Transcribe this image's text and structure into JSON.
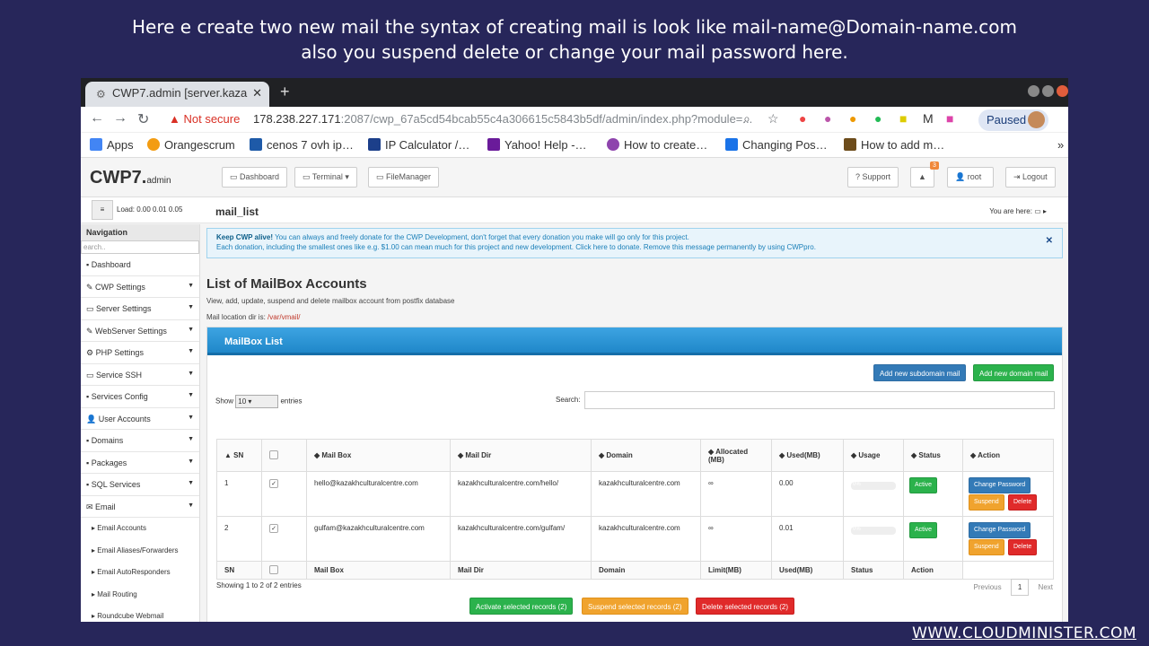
{
  "caption": {
    "line1": "Here e create two new mail the syntax of creating mail is look like mail-name@Domain-name.com",
    "line2": "also you suspend delete or change your mail password here."
  },
  "watermark": "WWW.CLOUDMINISTER.COM",
  "browser": {
    "tab_title": "CWP7.admin [server.kaza",
    "not_secure": "Not secure",
    "url_host": "178.238.227.171",
    "url_rest": ":2087/cwp_67a5cd54bcab55c4a306615c5843b5df/admin/index.php?module=...",
    "paused": "Paused",
    "bookmarks": [
      "Apps",
      "Orangescrum",
      "cenos 7 ovh ip…",
      "IP Calculator /…",
      "Yahoo! Help -…",
      "How to create…",
      "Changing Pos…",
      "How to add m…"
    ]
  },
  "header": {
    "logo": "CWP7.",
    "logo_small": "admin",
    "dashboard": "Dashboard",
    "terminal": "Terminal",
    "filemanager": "FileManager",
    "support": "Support",
    "notif_count": "3",
    "user": "root",
    "logout": "Logout"
  },
  "subheader": {
    "load": "Load: 0.00  0.01  0.05",
    "crumb": "mail_list",
    "you_are_here": "You are here:"
  },
  "sidebar": {
    "heading": "Navigation",
    "search_placeholder": "earch..",
    "items": [
      "Dashboard",
      "CWP Settings",
      "Server Settings",
      "WebServer Settings",
      "PHP Settings",
      "Service SSH",
      "Services Config",
      "User Accounts",
      "Domains",
      "Packages",
      "SQL Services",
      "Email"
    ],
    "subitems": [
      "Email Accounts",
      "Email Aliases/Forwarders",
      "Email AutoResponders",
      "Mail Routing",
      "Roundcube Webmail"
    ]
  },
  "alert": {
    "bold": "Keep CWP alive!",
    "line1": " You can always and freely donate for the CWP Development, don't forget that every donation you make will go only for this project.",
    "line2": "Each donation, including the smallest ones like e.g. $1.00 can mean much for this project and new development. Click here to donate. Remove this message permanently by using CWPpro."
  },
  "main": {
    "title": "List of MailBox Accounts",
    "description": "View, add, update, suspend and delete mailbox account from postfix database",
    "dir_label": "Mail location dir is: ",
    "dir_value": "/var/vmail/",
    "panel_title": "MailBox List",
    "add_subdomain": "Add new subdomain mail",
    "add_domain": "Add new domain mail",
    "show": "Show",
    "show_value": "10",
    "entries": "entries",
    "search": "Search:"
  },
  "table": {
    "headers": [
      "SN",
      "",
      "Mail Box",
      "Mail Dir",
      "Domain",
      "Allocated (MB)",
      "Used(MB)",
      "Usage",
      "Status",
      "Action"
    ],
    "footers": [
      "SN",
      "",
      "Mail Box",
      "Mail Dir",
      "Domain",
      "Limit(MB)",
      "Used(MB)",
      "Status",
      "Action",
      ""
    ],
    "rows": [
      {
        "sn": "1",
        "mailbox": "hello@kazakhculturalcentre.com",
        "maildir": "kazakhculturalcentre.com/hello/",
        "domain": "kazakhculturalcentre.com",
        "allocated": "∞",
        "used": "0.00",
        "usage": "0%",
        "status": "Active"
      },
      {
        "sn": "2",
        "mailbox": "gulfam@kazakhculturalcentre.com",
        "maildir": "kazakhculturalcentre.com/gulfam/",
        "domain": "kazakhculturalcentre.com",
        "allocated": "∞",
        "used": "0.01",
        "usage": "0%",
        "status": "Active"
      }
    ],
    "change_password": "Change Password",
    "suspend": "Suspend",
    "delete": "Delete"
  },
  "footer": {
    "info": "Showing 1 to 2 of 2 entries",
    "previous": "Previous",
    "page": "1",
    "next": "Next",
    "activate_selected": "Activate selected records (2)",
    "suspend_selected": "Suspend selected records (2)",
    "delete_selected": "Delete selected records (2)"
  }
}
